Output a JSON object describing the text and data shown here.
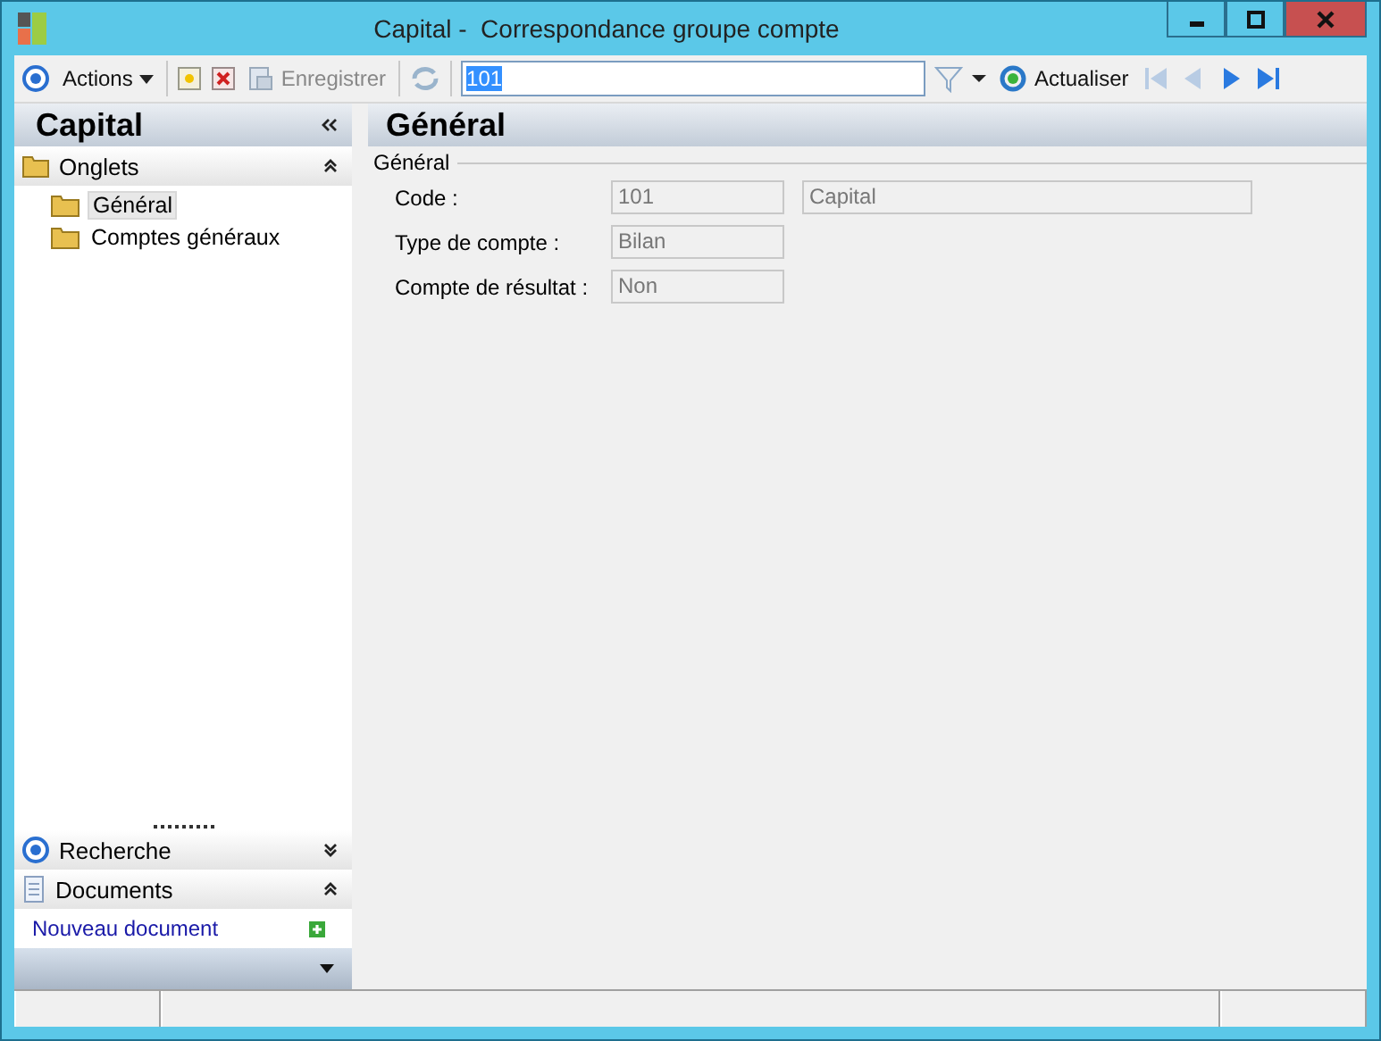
{
  "window": {
    "title": "Capital -  Correspondance groupe compte"
  },
  "toolbar": {
    "actions": "Actions",
    "save": "Enregistrer",
    "save_disabled": true,
    "search_value": "101",
    "refresh": "Actualiser"
  },
  "sidebar": {
    "title": "Capital",
    "sections": [
      {
        "kind": "tree",
        "label": "Onglets",
        "expanded": true,
        "children": [
          {
            "label": "Général",
            "selected": true
          },
          {
            "label": "Comptes généraux",
            "selected": false
          }
        ]
      },
      {
        "kind": "search",
        "label": "Recherche",
        "expanded": false
      },
      {
        "kind": "documents",
        "label": "Documents",
        "expanded": true,
        "link": "Nouveau document"
      }
    ]
  },
  "content": {
    "title": "Général",
    "group": "Général",
    "fields": [
      {
        "label": "Code :",
        "values": [
          "101",
          "Capital"
        ]
      },
      {
        "label": "Type de compte :",
        "values": [
          "Bilan"
        ]
      },
      {
        "label": "Compte de résultat :",
        "values": [
          "Non"
        ]
      }
    ]
  }
}
